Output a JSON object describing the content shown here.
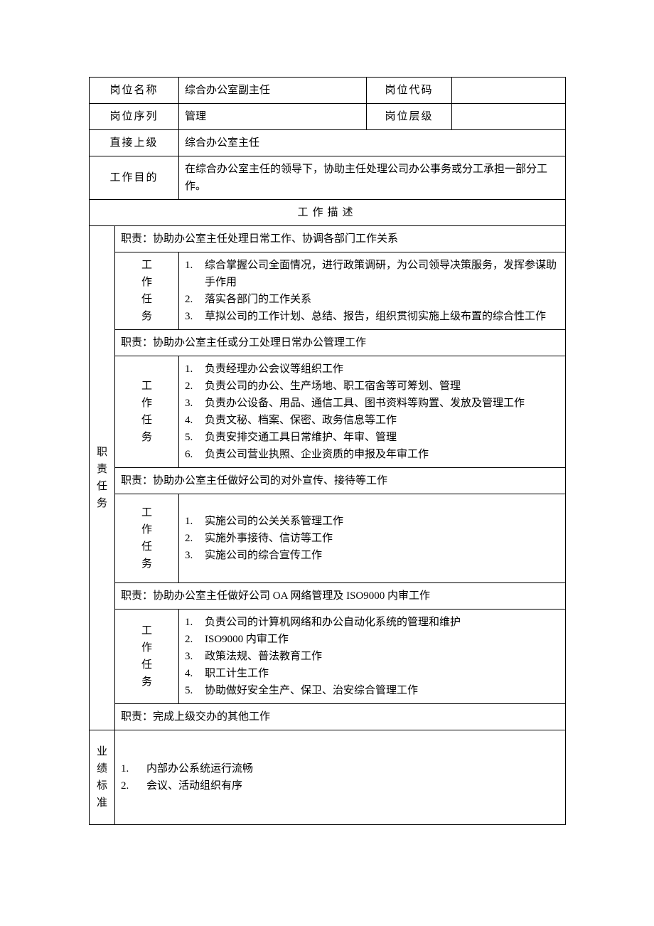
{
  "labels": {
    "position_name": "岗位名称",
    "position_code": "岗位代码",
    "position_series": "岗位序列",
    "position_level": "岗位层级",
    "supervisor": "直接上级",
    "purpose": "工作目的",
    "description": "工作描述",
    "task": "工作任务",
    "duties": "职责任务",
    "performance": "业绩标准"
  },
  "header": {
    "position_name": "综合办公室副主任",
    "position_code": "",
    "position_series": "管理",
    "position_level": "",
    "supervisor": "综合办公室主任",
    "purpose": "在综合办公室主任的领导下，协助主任处理公司办公事务或分工承担一部分工作。"
  },
  "duties": [
    {
      "title": "职责：协助办公室主任处理日常工作、协调各部门工作关系",
      "tasks": [
        "综合掌握公司全面情况，进行政策调研，为公司领导决策服务，发挥参谋助手作用",
        "落实各部门的工作关系",
        "草拟公司的工作计划、总结、报告，组织贯彻实施上级布置的综合性工作"
      ]
    },
    {
      "title": "职责：协助办公室主任或分工处理日常办公管理工作",
      "tasks": [
        "负责经理办公会议等组织工作",
        "负责公司的办公、生产场地、职工宿舍等可筹划、管理",
        "负责办公设备、用品、通信工具、图书资料等购置、发放及管理工作",
        "负责文秘、档案、保密、政务信息等工作",
        "负责安排交通工具日常维护、年审、管理",
        "负责公司营业执照、企业资质的申报及年审工作"
      ]
    },
    {
      "title": "职责：协助办公室主任做好公司的对外宣传、接待等工作",
      "tasks": [
        "实施公司的公关关系管理工作",
        "实施外事接待、信访等工作",
        "实施公司的综合宣传工作"
      ]
    },
    {
      "title": "职责：协助办公室主任做好公司 OA 网络管理及 ISO9000 内审工作",
      "tasks": [
        "负责公司的计算机网络和办公自动化系统的管理和维护",
        "ISO9000 内审工作",
        "政策法规、普法教育工作",
        "职工计生工作",
        "协助做好安全生产、保卫、治安综合管理工作"
      ]
    },
    {
      "title": "职责：完成上级交办的其他工作",
      "tasks": []
    }
  ],
  "performance": [
    "内部办公系统运行流畅",
    "会议、活动组织有序"
  ]
}
